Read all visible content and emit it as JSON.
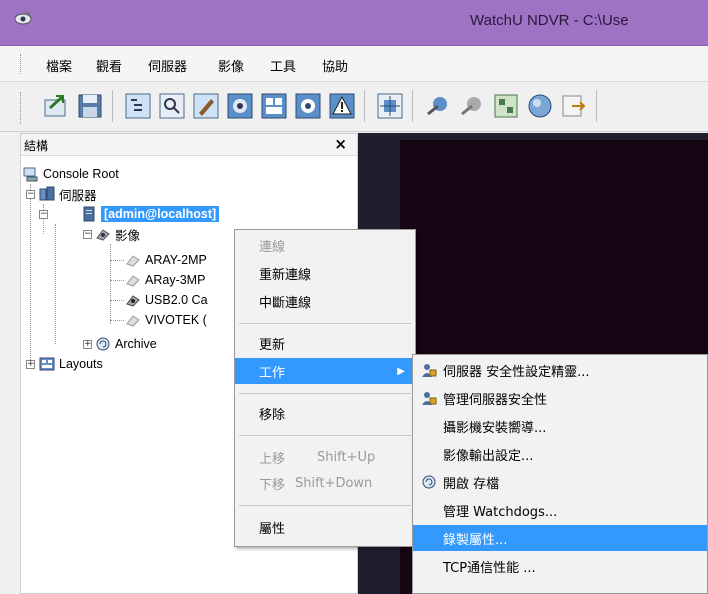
{
  "window": {
    "title": "WatchU NDVR - C:\\Use"
  },
  "menubar": {
    "items": [
      "檔案",
      "觀看",
      "伺服器",
      "影像",
      "工具",
      "協助"
    ]
  },
  "toolbar": {
    "buttons": [
      "import-icon",
      "save-icon",
      "tree-view-icon",
      "preview-icon",
      "edit-icon",
      "camera-dome-icon",
      "layout-icon",
      "camera-icon",
      "alarm-icon",
      "fullscreen-icon",
      "ptz-icon",
      "ptz2-icon",
      "grid-icon",
      "globe-icon",
      "export-icon"
    ]
  },
  "structure": {
    "title": "結構",
    "close": "×",
    "tree": {
      "root": "Console Root",
      "servers": "伺服器",
      "server": "[admin@localhost]",
      "video": "影像",
      "cameras": [
        "ARAY-2MP",
        "ARay-3MP",
        "USB2.0 Ca",
        "VIVOTEK ("
      ],
      "archive": "Archive",
      "layouts": "Layouts"
    }
  },
  "context_menu": {
    "connect": "連線",
    "reconnect": "重新連線",
    "disconnect": "中斷連線",
    "refresh": "更新",
    "tasks": "工作",
    "remove": "移除",
    "move_up": "上移",
    "move_up_shortcut": "Shift+Up",
    "move_down": "下移",
    "move_down_shortcut": "Shift+Down",
    "properties": "屬性"
  },
  "submenu": {
    "items": [
      "伺服器 安全性設定精靈...",
      "管理伺服器安全性",
      "攝影機安裝嚮導...",
      "影像輸出設定...",
      "開啟 存檔",
      "管理 Watchdogs...",
      "錄製屬性...",
      "TCP通信性能 ..."
    ],
    "highlighted_index": 6
  },
  "colors": {
    "titlebar": "#9f73c4",
    "highlight": "#3399ff",
    "video_bg": "#160512"
  }
}
